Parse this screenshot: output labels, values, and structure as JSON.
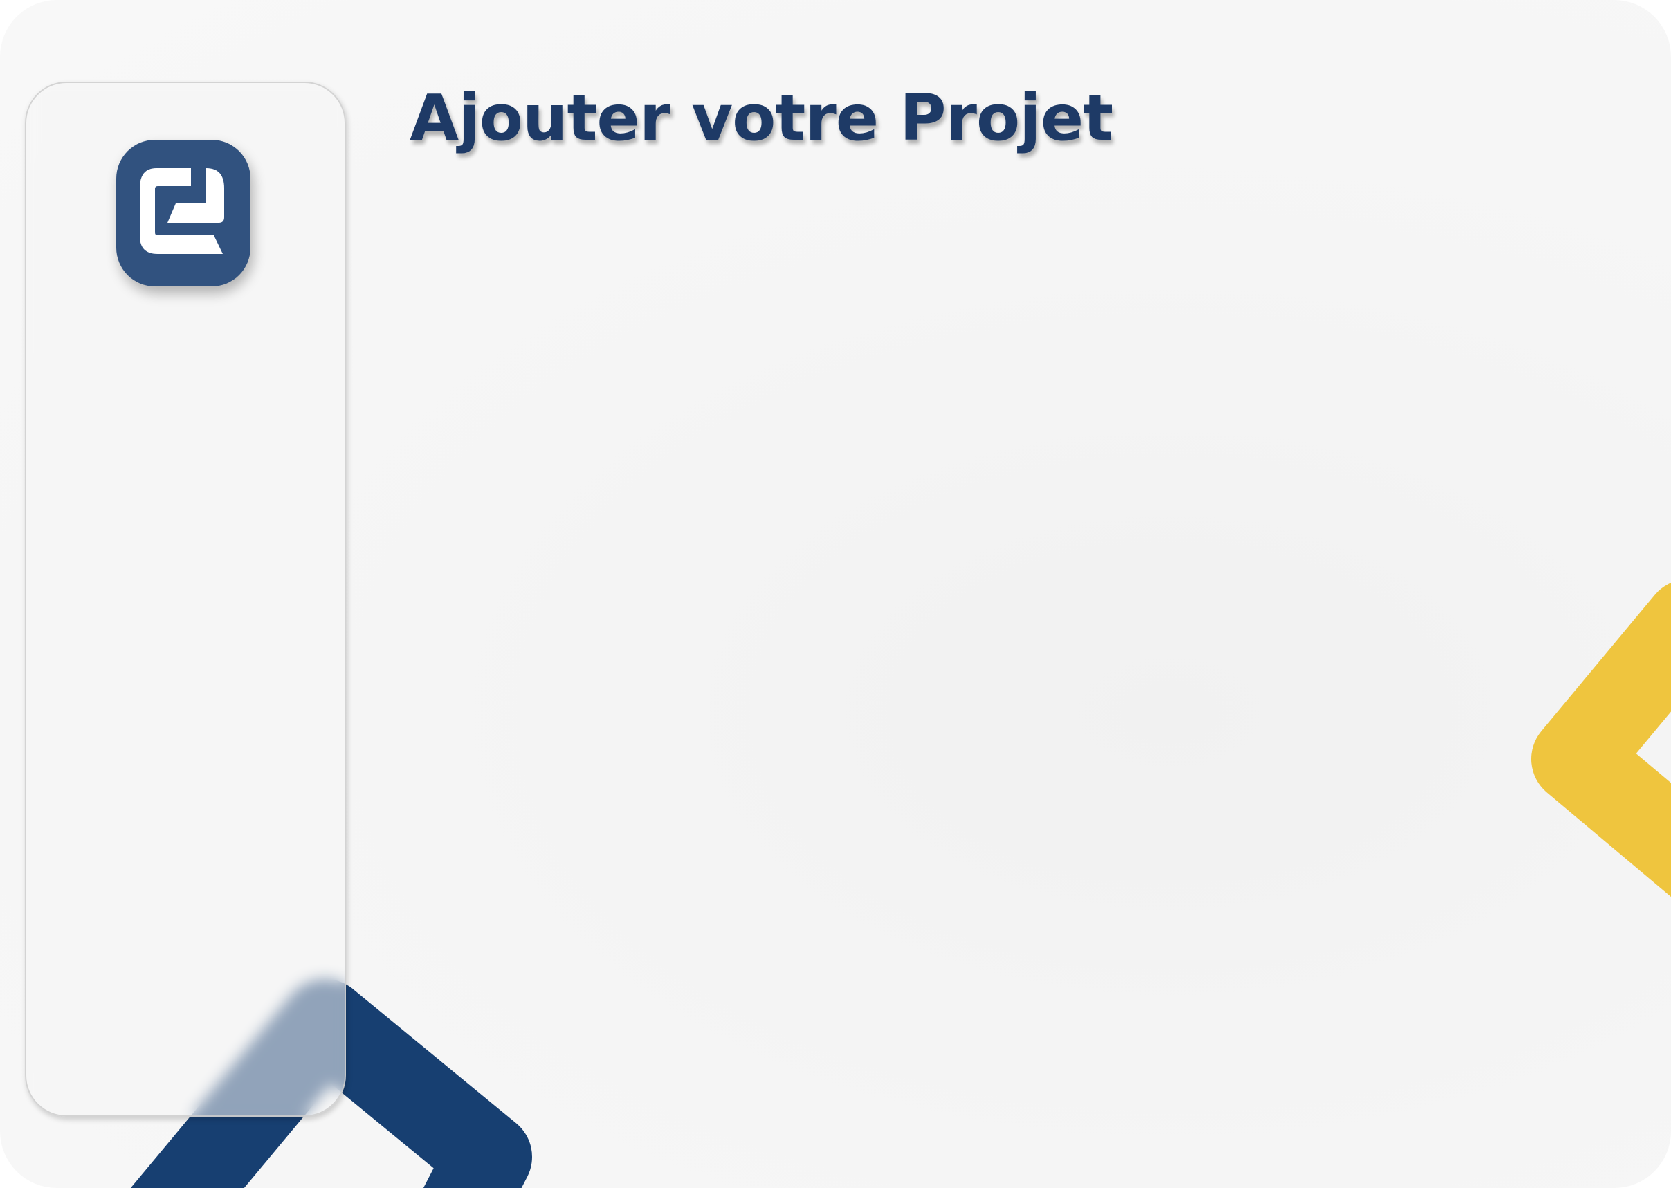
{
  "header": {
    "title": "Ajouter votre Projet"
  },
  "sidebar": {
    "logo_icon": "brand-logo-icon"
  },
  "colors": {
    "brand_navy": "#173f71",
    "brand_blue": "#31527f",
    "title_text": "#1e3a66",
    "accent_yellow": "#efc53e",
    "background": "#f6f6f6"
  }
}
